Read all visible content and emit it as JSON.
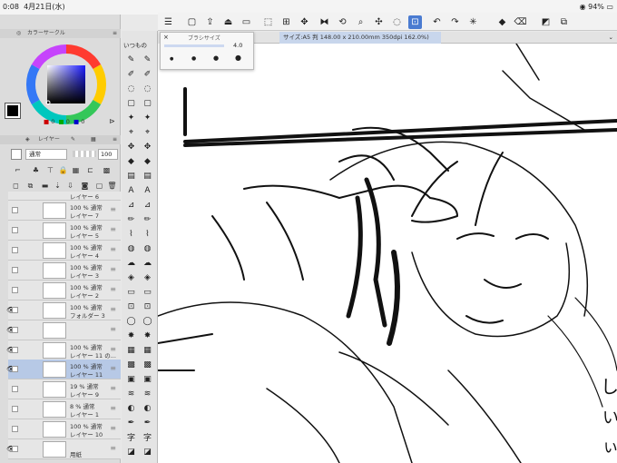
{
  "status": {
    "time": "0:08",
    "date": "4月21日(水)",
    "battery": "94%"
  },
  "toolbar": {
    "icons": [
      "menu-icon",
      "new-file-icon",
      "export-icon",
      "import-icon",
      "hand-icon",
      "move-icon",
      "transform-icon",
      "flip-icon",
      "rotate-icon",
      "zoom-icon",
      "select-all-icon",
      "deselect-icon",
      "snap-icon",
      "undo-icon",
      "redo-icon",
      "loading-icon",
      "fill-icon",
      "eraser-icon",
      "grid-icon",
      "layer-icon"
    ]
  },
  "tab": {
    "label": "サイズ:A5 判 148.00 x 210.00mm 350dpi 162.0%)",
    "close": "⌄"
  },
  "brush_popup": {
    "title": "ブラシサイズ",
    "close": "×",
    "value": "4.0"
  },
  "color_panel": {
    "title": "カラーサークル",
    "r": "0",
    "g": "0",
    "b": "0"
  },
  "layer_panel": {
    "title": "レイヤー",
    "blend_mode": "通常",
    "opacity": "100",
    "top_partial": "レイヤー 6",
    "layers": [
      {
        "pct": "100 %  通常",
        "name": "レイヤー 7",
        "eye": ""
      },
      {
        "pct": "100 %  通常",
        "name": "レイヤー 5",
        "eye": ""
      },
      {
        "pct": "100 %  通常",
        "name": "レイヤー 4",
        "eye": ""
      },
      {
        "pct": "100 %  通常",
        "name": "レイヤー 3",
        "eye": ""
      },
      {
        "pct": "100 %  通常",
        "name": "レイヤー 2",
        "eye": ""
      },
      {
        "pct": "100 %  通常",
        "name": "フォルダー 3",
        "eye": "👁"
      },
      {
        "pct": "",
        "name": "",
        "eye": "👁"
      },
      {
        "pct": "100 %  通常",
        "name": "レイヤー 11 の...",
        "eye": "👁"
      },
      {
        "pct": "100 %  通常",
        "name": "レイヤー 11",
        "eye": "👁"
      },
      {
        "pct": "19 %  通常",
        "name": "レイヤー 9",
        "eye": ""
      },
      {
        "pct": "8 %  通常",
        "name": "レイヤー 1",
        "eye": ""
      },
      {
        "pct": "100 %  通常",
        "name": "レイヤー 10",
        "eye": ""
      },
      {
        "pct": "",
        "name": "用紙",
        "eye": "👁"
      }
    ]
  },
  "tool_palette": {
    "label": "いつもの"
  },
  "colors": {
    "accent": "#4a7bd1",
    "panel": "#dcdcdc",
    "selected_layer": "#b7c9e6"
  }
}
